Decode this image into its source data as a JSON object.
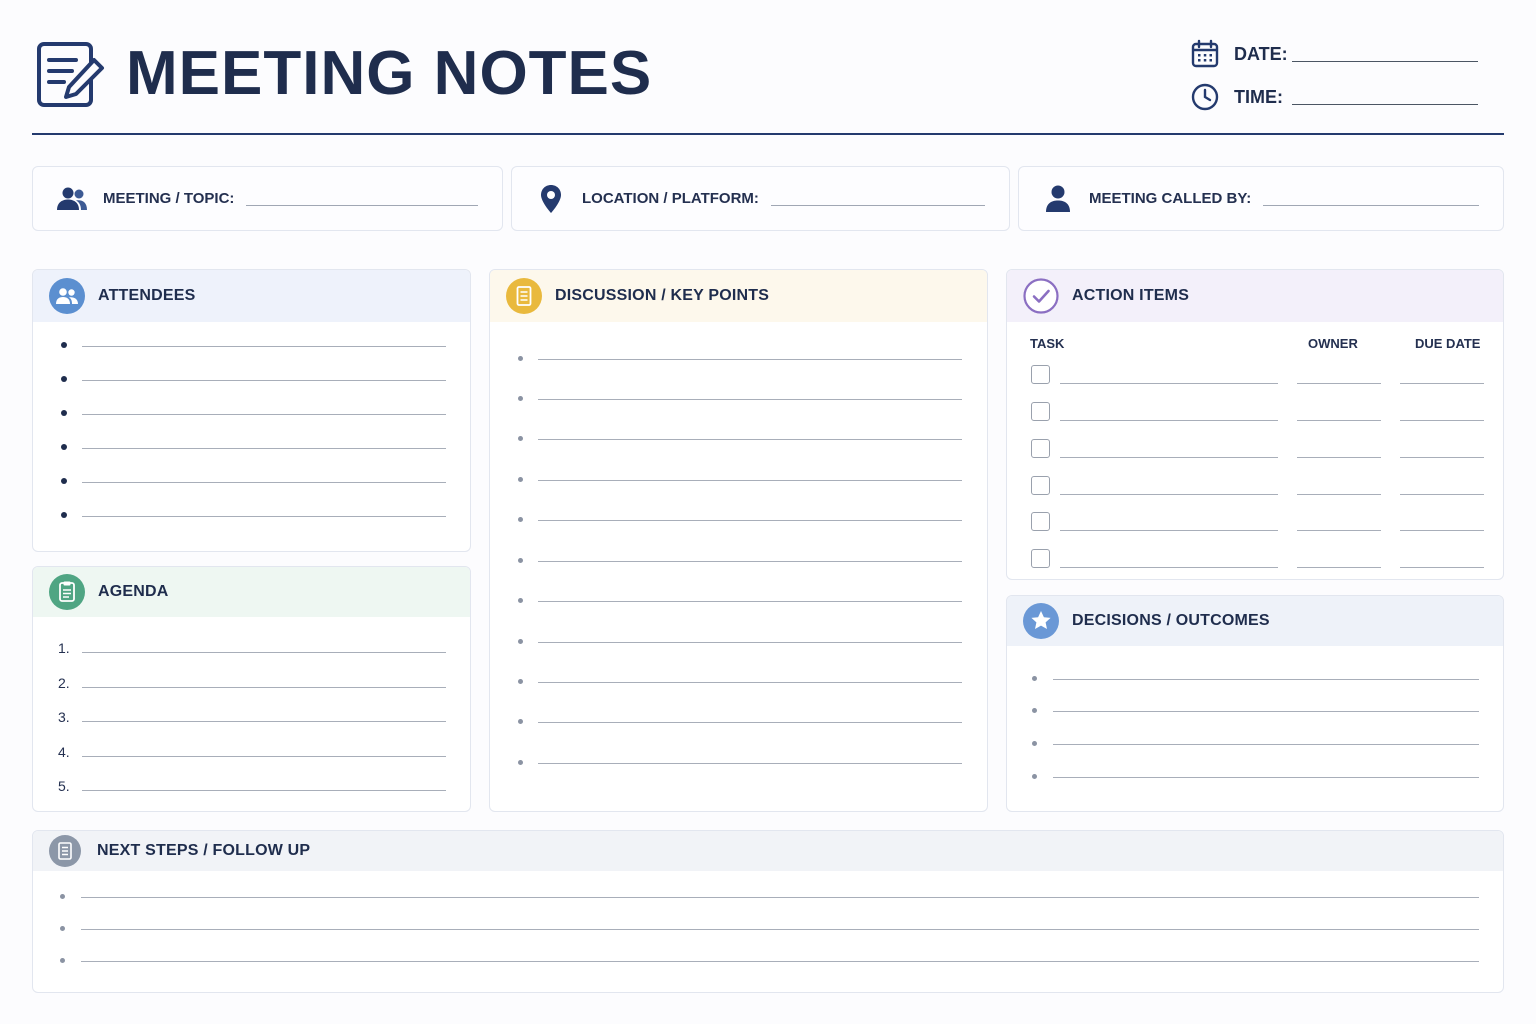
{
  "header": {
    "title": "MEETING NOTES",
    "date_label": "DATE:",
    "time_label": "TIME:"
  },
  "info": {
    "topic_label": "MEETING / TOPIC:",
    "location_label": "LOCATION / PLATFORM:",
    "called_by_label": "MEETING CALLED BY:"
  },
  "sections": {
    "attendees": "ATTENDEES",
    "agenda": "AGENDA",
    "discussion": "DISCUSSION / KEY POINTS",
    "action_items": "ACTION ITEMS",
    "decisions": "DECISIONS / OUTCOMES",
    "next_steps": "NEXT STEPS / FOLLOW UP"
  },
  "agenda_numbers": [
    "1.",
    "2.",
    "3.",
    "4.",
    "5."
  ],
  "action_columns": {
    "task": "TASK",
    "owner": "OWNER",
    "due": "DUE DATE"
  },
  "colors": {
    "navy": "#1f2d4d",
    "attendees_accent": "#5b8fd0",
    "agenda_accent": "#4fa583",
    "discussion_accent": "#e9b93d",
    "action_accent": "#8b6fc2",
    "decisions_accent": "#6a98d6",
    "next_accent": "#8c97a8"
  }
}
